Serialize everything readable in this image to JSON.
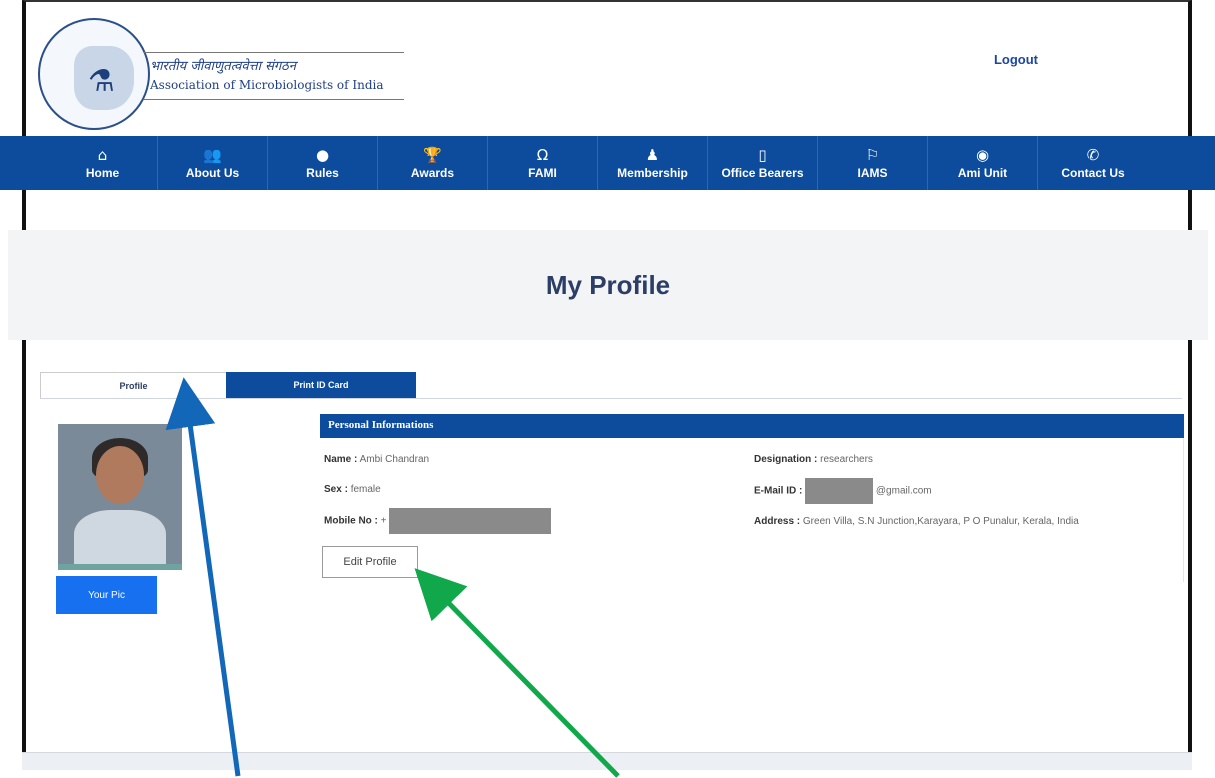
{
  "header": {
    "logo_text_hindi": "भारतीय जीवाणुतत्ववेत्ता संगठन",
    "logo_text_english": "Association of Microbiologists of India",
    "logout_label": "Logout"
  },
  "nav": [
    {
      "icon": "home-icon",
      "glyph": "⌂",
      "label": "Home"
    },
    {
      "icon": "users-icon",
      "glyph": "👥",
      "label": "About Us"
    },
    {
      "icon": "circle-icon",
      "glyph": "●",
      "label": "Rules"
    },
    {
      "icon": "trophy-icon",
      "glyph": "🏆",
      "label": "Awards"
    },
    {
      "icon": "github-icon",
      "glyph": "Ω",
      "label": "FAMI"
    },
    {
      "icon": "user-icon",
      "glyph": "♟",
      "label": "Membership"
    },
    {
      "icon": "tablet-icon",
      "glyph": "▯",
      "label": "Office Bearers"
    },
    {
      "icon": "flag-icon",
      "glyph": "⚐",
      "label": "IAMS"
    },
    {
      "icon": "eye-icon",
      "glyph": "◉",
      "label": "Ami Unit"
    },
    {
      "icon": "phone-icon",
      "glyph": "✆",
      "label": "Contact Us"
    }
  ],
  "page": {
    "title": "My Profile"
  },
  "tabs": {
    "profile": "Profile",
    "print_id_card": "Print ID Card"
  },
  "photo": {
    "button_label": "Your Pic"
  },
  "personal": {
    "header": "Personal Informations",
    "name_label": "Name :",
    "name_value": "Ambi Chandran",
    "sex_label": "Sex :",
    "sex_value": "female",
    "mobile_label": "Mobile No :",
    "mobile_value": "+",
    "designation_label": "Designation :",
    "designation_value": "researchers",
    "email_label": "E-Mail ID :",
    "email_value_suffix": "@gmail.com",
    "address_label": "Address :",
    "address_value": "Green Villa, S.N Junction,Karayara, P O Punalur, Kerala, India",
    "edit_button": "Edit Profile"
  },
  "colors": {
    "brand_blue": "#0d4c9c",
    "pic_button_blue": "#1770f0",
    "annotation_blue_arrow": "#1267b8",
    "annotation_green_arrow": "#10a84a"
  }
}
